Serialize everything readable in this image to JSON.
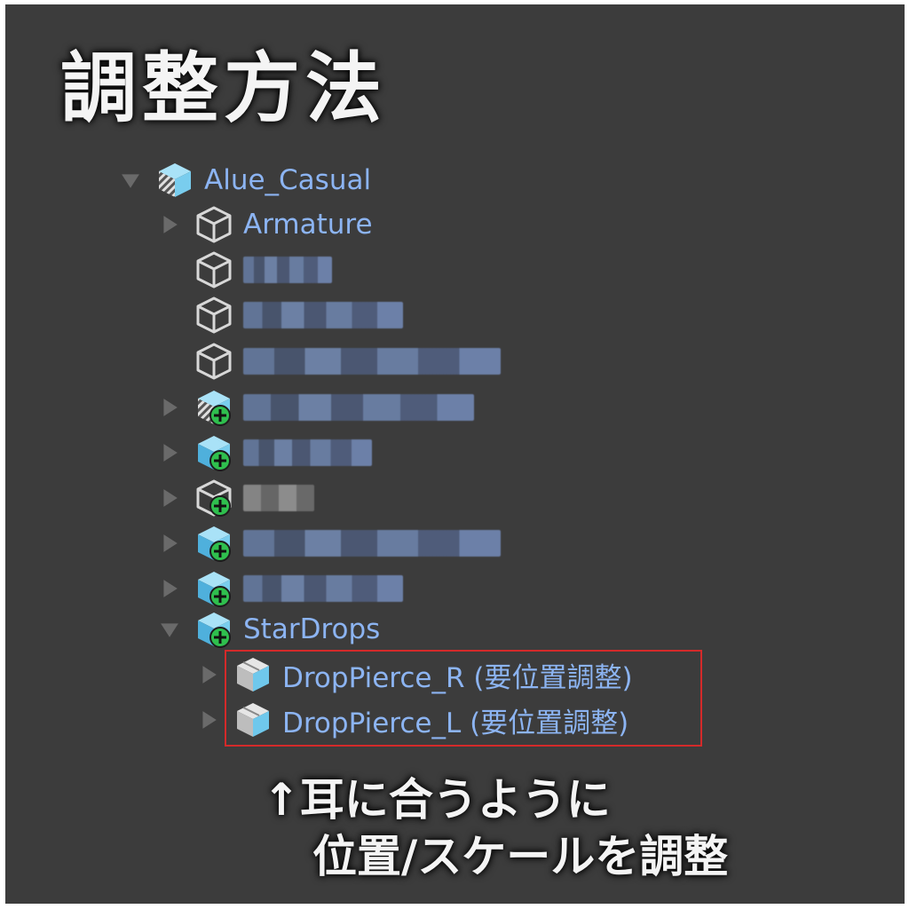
{
  "heading": "調整方法",
  "hierarchy": {
    "root": {
      "label": "Alue_Casual"
    },
    "armature": {
      "label": "Armature"
    },
    "stardrops": {
      "label": "StarDrops"
    },
    "children": [
      {
        "label": "DropPierce_R (要位置調整)"
      },
      {
        "label": "DropPierce_L (要位置調整)"
      }
    ]
  },
  "note": {
    "line1": "↑耳に合うように",
    "line2": "位置/スケールを調整"
  },
  "colors": {
    "panel_bg": "#3c3c3c",
    "label_blue": "#8cb4f2",
    "highlight_red": "#d42a2a",
    "add_badge_green": "#2fbf4e",
    "cube_cyan": "#6fc8ec"
  },
  "icons": {
    "expanded": "triangle-down-icon",
    "collapsed": "triangle-right-icon",
    "prefab": "prefab-cube-icon",
    "object": "game-object-icon",
    "added": "add-badge-icon"
  }
}
